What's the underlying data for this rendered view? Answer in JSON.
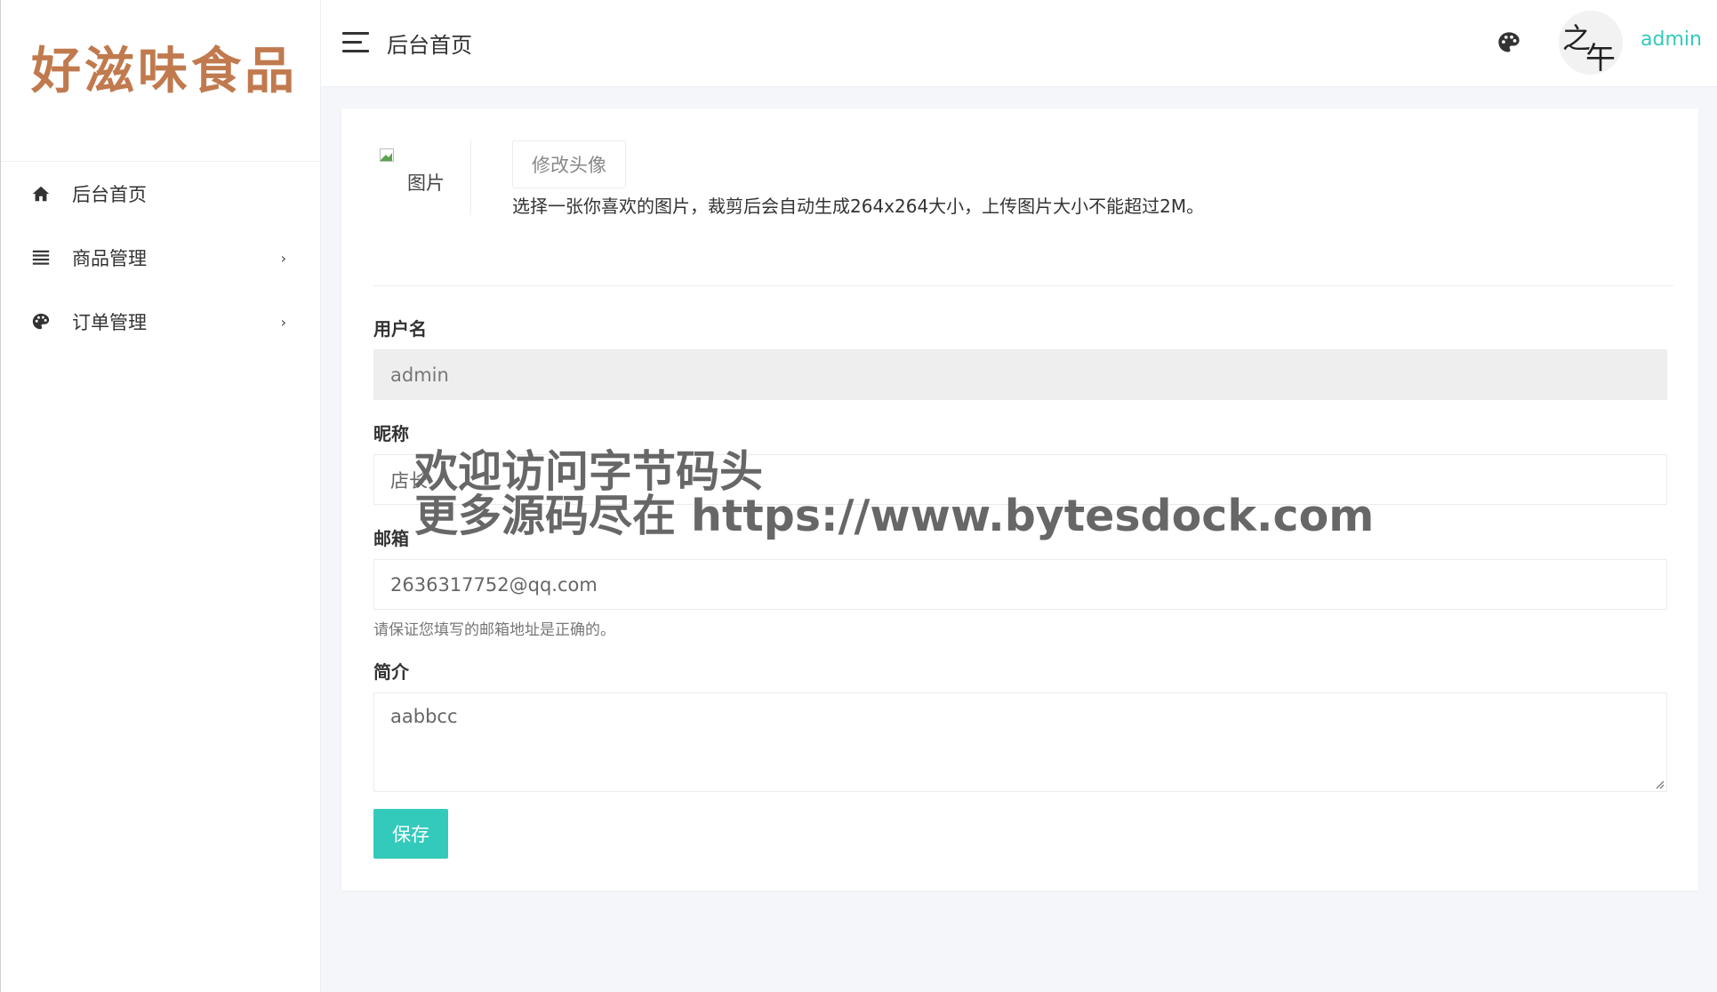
{
  "brand": {
    "name": "好滋味食品",
    "color": "#c07a4e"
  },
  "sidebar": {
    "items": [
      {
        "label": "后台首页",
        "icon": "home-icon",
        "has_arrow": false
      },
      {
        "label": "商品管理",
        "icon": "list-icon",
        "has_arrow": true
      },
      {
        "label": "订单管理",
        "icon": "palette-icon",
        "has_arrow": true
      }
    ],
    "arrow_glyph": "›"
  },
  "topbar": {
    "title": "后台首页",
    "user_name": "admin",
    "avatar_glyphs": [
      "之",
      "午"
    ]
  },
  "avatar_section": {
    "image_alt": "图片",
    "change_button": "修改头像",
    "hint": "选择一张你喜欢的图片，裁剪后会自动生成264x264大小，上传图片大小不能超过2M。"
  },
  "form": {
    "username": {
      "label": "用户名",
      "value": "admin"
    },
    "nickname": {
      "label": "昵称",
      "value": "店长"
    },
    "email": {
      "label": "邮箱",
      "value": "2636317752@qq.com",
      "help": "请保证您填写的邮箱地址是正确的。"
    },
    "bio": {
      "label": "简介",
      "value": "aabbcc"
    },
    "save_label": "保存"
  },
  "watermark": {
    "line1": "欢迎访问字节码头",
    "line2": "更多源码尽在  https://www.bytesdock.com"
  },
  "colors": {
    "accent": "#33cabb",
    "brand": "#c07a4e",
    "background": "#f4f6f9"
  }
}
